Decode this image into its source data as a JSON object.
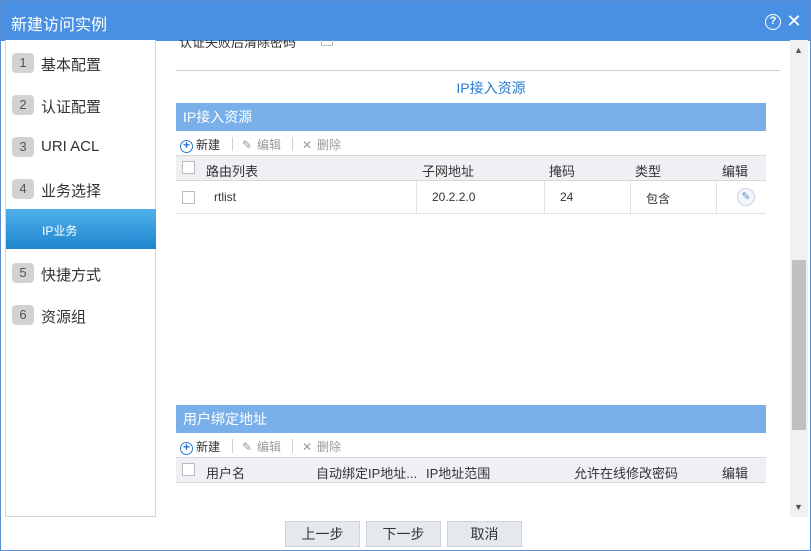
{
  "dialog": {
    "title": "新建访问实例",
    "help_glyph": "?",
    "close_glyph": "✕"
  },
  "steps": [
    {
      "num": "1",
      "label": "基本配置"
    },
    {
      "num": "2",
      "label": "认证配置"
    },
    {
      "num": "3",
      "label": "URI ACL"
    },
    {
      "num": "4",
      "label": "业务选择"
    },
    {
      "num": "",
      "label": "IP业务"
    },
    {
      "num": "5",
      "label": "快捷方式"
    },
    {
      "num": "6",
      "label": "资源组"
    }
  ],
  "section": {
    "cut_label": "认证失败后清除密码",
    "title": "IP接入资源"
  },
  "ip_panel": {
    "header": "IP接入资源",
    "toolbar": {
      "add": "新建",
      "edit": "编辑",
      "delete": "删除"
    },
    "columns": [
      "路由列表",
      "子网地址",
      "掩码",
      "类型",
      "编辑"
    ],
    "rows": [
      {
        "route_list": "rtlist",
        "subnet": "20.2.2.0",
        "mask": "24",
        "type": "包含"
      }
    ]
  },
  "user_panel": {
    "header": "用户绑定地址",
    "toolbar": {
      "add": "新建",
      "edit": "编辑",
      "delete": "删除"
    },
    "columns": [
      "用户名",
      "自动绑定IP地址...",
      "IP地址范围",
      "允许在线修改密码",
      "编辑"
    ]
  },
  "footer": {
    "prev": "上一步",
    "next": "下一步",
    "cancel": "取消"
  },
  "colors": {
    "titlebar": "#4a90e2",
    "panel_header": "#79b0ea",
    "active_step": "#1f86cf",
    "accent_text": "#2a7bd0"
  },
  "icons": [
    "help-icon",
    "close-icon",
    "add-icon",
    "pencil-icon",
    "delete-icon"
  ]
}
